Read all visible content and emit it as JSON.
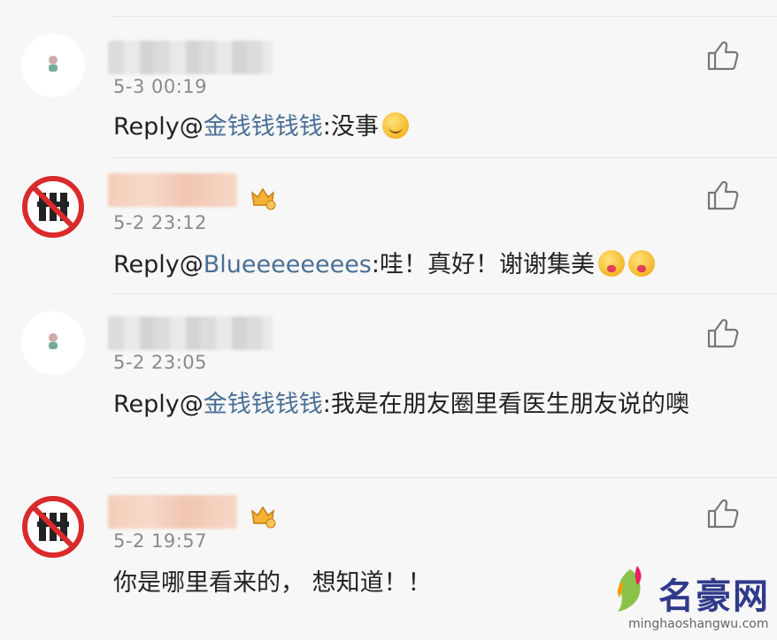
{
  "comments": [
    {
      "time": "5-3 00:19",
      "reply_prefix": "Reply@",
      "mention": "金钱钱钱钱",
      "text": ":没事",
      "emojis": [
        "smile-emoji"
      ]
    },
    {
      "time": "5-2 23:12",
      "reply_prefix": "Reply@",
      "mention": "Blueeeeeeees",
      "text": ":哇！真好！谢谢集美",
      "emojis": [
        "drool-emoji",
        "drool-emoji"
      ]
    },
    {
      "time": "5-2 23:05",
      "reply_prefix": "Reply@",
      "mention": "金钱钱钱钱",
      "text": ":我是在朋友圈里看医生朋友说的噢",
      "emojis": []
    },
    {
      "time": "5-2 19:57",
      "reply_prefix": "",
      "mention": "",
      "text": "你是哪里看来的， 想知道！！",
      "emojis": []
    }
  ],
  "watermark": {
    "title": "名豪网",
    "url": "minghaoshangwu.com"
  },
  "icons": {
    "like": "thumbs-up-icon",
    "avatar_banned": "banned-avatar-icon",
    "vip": "crown-badge-icon"
  },
  "colors": {
    "mention": "#4a6f96",
    "time": "#8a8a8a",
    "background": "#f7f7f7"
  }
}
